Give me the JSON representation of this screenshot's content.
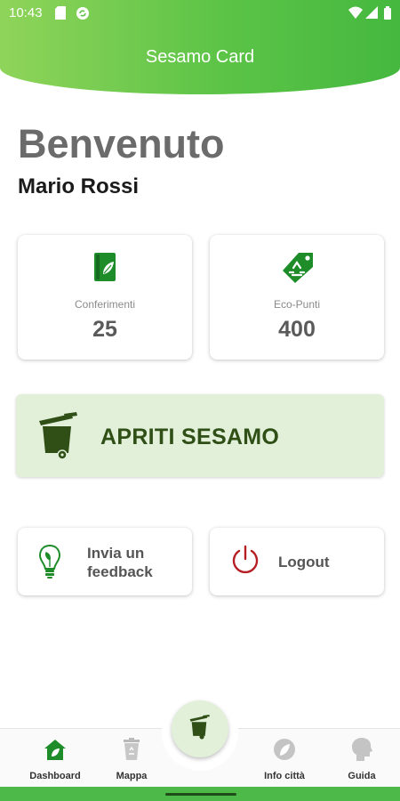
{
  "status_bar": {
    "time": "10:43",
    "icons": [
      "sd-card-icon",
      "sync-icon",
      "wifi-icon",
      "signal-icon",
      "battery-icon"
    ]
  },
  "header": {
    "title": "Sesamo Card"
  },
  "welcome": {
    "greeting": "Benvenuto",
    "user_name": "Mario Rossi"
  },
  "stats": {
    "conferimenti": {
      "label": "Conferimenti",
      "value": "25",
      "icon": "book-leaf-icon"
    },
    "eco_punti": {
      "label": "Eco-Punti",
      "value": "400",
      "icon": "recycle-tag-icon"
    }
  },
  "open_button": {
    "label": "APRITI SESAMO",
    "icon": "trash-bin-icon"
  },
  "actions": {
    "feedback": {
      "label_line1": "Invia un",
      "label_line2": "feedback",
      "icon": "lightbulb-icon"
    },
    "logout": {
      "label": "Logout",
      "icon": "power-icon"
    }
  },
  "bottom_nav": {
    "items": [
      {
        "label": "Dashboard",
        "icon": "home-leaf-icon",
        "active": true
      },
      {
        "label": "Mappa",
        "icon": "recycle-bin-icon",
        "active": false
      },
      {
        "label": "Info città",
        "icon": "globe-leaf-icon",
        "active": false
      },
      {
        "label": "Guida",
        "icon": "head-icon",
        "active": false
      }
    ],
    "center_icon": "trash-bin-icon"
  },
  "colors": {
    "brand_green": "#4cb948",
    "icon_green": "#1f8c2a",
    "dark_olive": "#2f4f17",
    "logout_red": "#b51f24",
    "light_green_bg": "#e2f0da"
  }
}
